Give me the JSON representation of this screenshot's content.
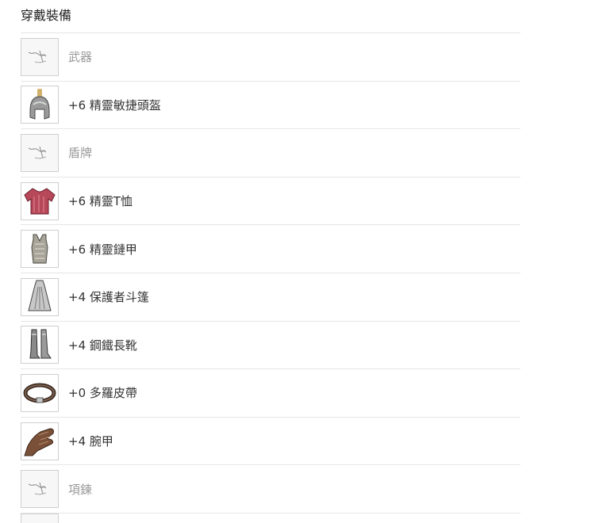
{
  "panel": {
    "title": "穿戴裝備"
  },
  "equipment": [
    {
      "slot": "weapon",
      "name": "武器",
      "icon": "empty-slot-icon",
      "empty": true
    },
    {
      "slot": "helmet",
      "name": "+6 精靈敏捷頭盔",
      "icon": "helmet-icon",
      "empty": false
    },
    {
      "slot": "shield",
      "name": "盾牌",
      "icon": "empty-slot-icon",
      "empty": true
    },
    {
      "slot": "tshirt",
      "name": "+6 精靈T恤",
      "icon": "tshirt-icon",
      "empty": false
    },
    {
      "slot": "armor",
      "name": "+6 精靈鏈甲",
      "icon": "chainmail-icon",
      "empty": false
    },
    {
      "slot": "cloak",
      "name": "+4 保護者斗篷",
      "icon": "cloak-icon",
      "empty": false
    },
    {
      "slot": "boots",
      "name": "+4 鋼鐵長靴",
      "icon": "boots-icon",
      "empty": false
    },
    {
      "slot": "belt",
      "name": "+0 多羅皮帶",
      "icon": "belt-icon",
      "empty": false
    },
    {
      "slot": "bracer",
      "name": "+4 腕甲",
      "icon": "glove-icon",
      "empty": false
    },
    {
      "slot": "necklace",
      "name": "項鍊",
      "icon": "empty-slot-icon",
      "empty": true
    }
  ],
  "colors": {
    "divider": "#e6e6e6",
    "slot_border": "#cfcfcf",
    "text": "#333333",
    "empty_text": "#9a9a9a"
  }
}
